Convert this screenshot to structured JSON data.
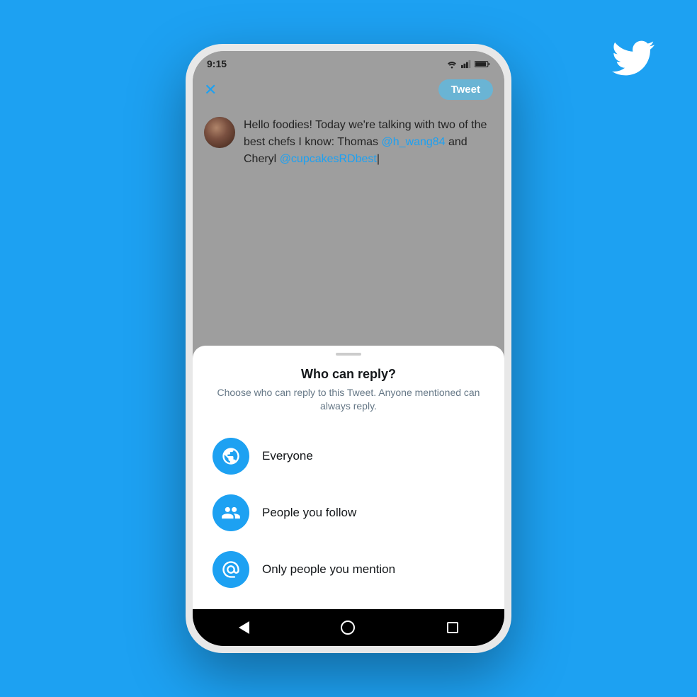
{
  "background_color": "#1DA1F2",
  "twitter_logo": "🐦",
  "phone": {
    "status_bar": {
      "time": "9:15",
      "icons": [
        "wifi",
        "signal",
        "battery"
      ]
    },
    "compose_header": {
      "close_label": "✕",
      "tweet_button_label": "Tweet"
    },
    "compose_area": {
      "tweet_text_before": "Hello foodies! Today we're talking with two of the best chefs I know: Thomas ",
      "mention_1": "@h_wang84",
      "tweet_text_middle": " and Cheryl ",
      "mention_2": "@cupcakesRDbest"
    },
    "bottom_sheet": {
      "handle": true,
      "title": "Who can reply?",
      "subtitle": "Choose who can reply to this Tweet. Anyone mentioned can always reply.",
      "options": [
        {
          "icon": "globe",
          "label": "Everyone"
        },
        {
          "icon": "people",
          "label": "People you follow"
        },
        {
          "icon": "at",
          "label": "Only people you mention"
        }
      ]
    },
    "android_nav": {
      "back_label": "◀",
      "home_label": "○",
      "recent_label": "□"
    }
  }
}
